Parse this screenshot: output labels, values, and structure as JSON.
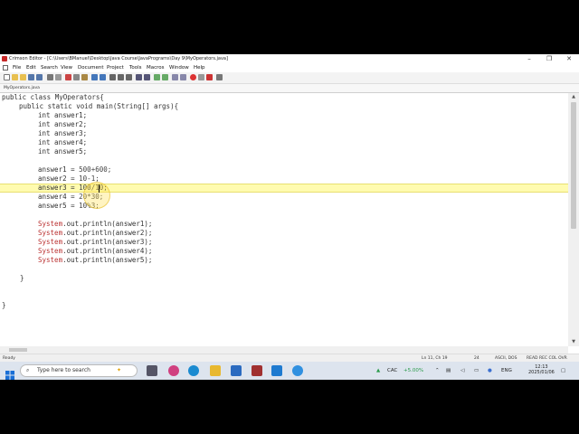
{
  "window": {
    "title": "Crimson Editor - [C:\\Users\\BManuel\\Desktop\\Java Course\\JavaPrograms\\Day 9\\MyOperators.java]"
  },
  "menu": [
    "File",
    "Edit",
    "Search",
    "View",
    "Document",
    "Project",
    "Tools",
    "Macros",
    "Window",
    "Help"
  ],
  "document_tab": "MyOperators.java",
  "code": {
    "l1": "public class MyOperators{",
    "l2": "public static void main(String[] args){",
    "decl": [
      "int answer1;",
      "int answer2;",
      "int answer3;",
      "int answer4;",
      "int answer5;"
    ],
    "assign": [
      {
        "lhs": "answer1 = ",
        "rhs": "500+600;"
      },
      {
        "lhs": "answer2 = ",
        "rhs": "10-1;"
      },
      {
        "lhs": "answer3 = ",
        "rhs": "100/10;"
      },
      {
        "lhs": "answer4 = ",
        "rhs": "20*30;"
      },
      {
        "lhs": "answer5 = ",
        "rhs": "10%3;"
      }
    ],
    "print_prefix": "System",
    "prints": [
      ".out.println(answer1);",
      ".out.println(answer2);",
      ".out.println(answer3);",
      ".out.println(answer4);",
      ".out.println(answer5);"
    ],
    "close_inner": "}",
    "close_outer": "}"
  },
  "status": {
    "left": "Ready",
    "position": "Ln 11, Ch 19",
    "number": "24",
    "encoding": "ASCII, DOS",
    "modes": "READ  REC  COL  OVR"
  },
  "taskbar": {
    "search_placeholder": "Type here to search",
    "weather_text": "CAC",
    "weather_value": "+5.00%",
    "lang": "ENG",
    "time": "12:13",
    "date": "2025/01/06"
  },
  "colors": {
    "highlight": "#fffbb0",
    "keyword": "#2233aa",
    "class": "#b33333"
  }
}
